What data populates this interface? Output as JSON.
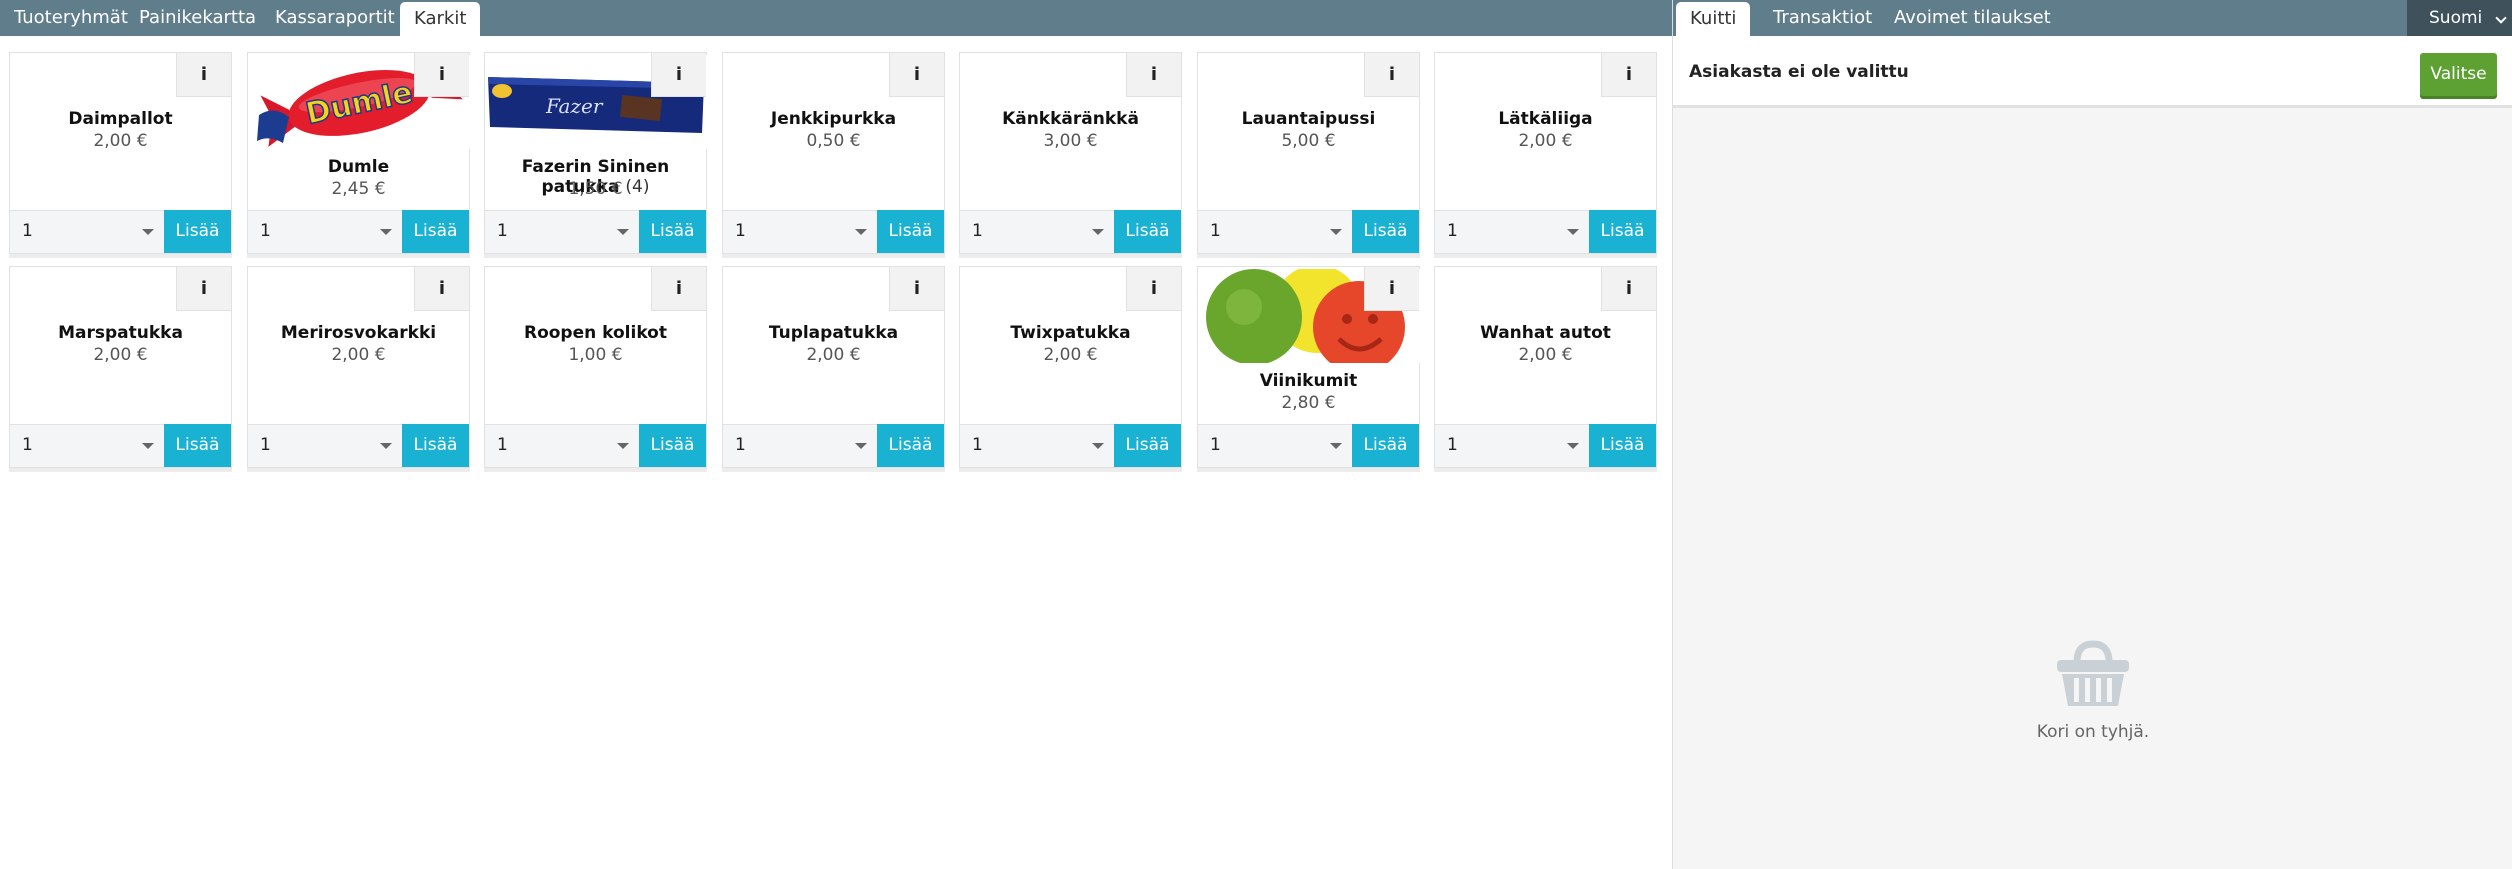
{
  "nav": {
    "tabs": [
      "Tuoteryhmät",
      "Painikekartta",
      "Kassaraportit",
      "Karkit"
    ],
    "active_tab": "Karkit"
  },
  "products": [
    {
      "name": "Daimpallot",
      "price": "2,00 €",
      "qty": "1",
      "add_label": "Lisää"
    },
    {
      "name": "Dumle",
      "price": "2,45 €",
      "qty": "1",
      "add_label": "Lisää",
      "image": "dumle-candy"
    },
    {
      "name": "Fazerin Sininen patukka",
      "qty_info": "(4)",
      "price": "1,50 €",
      "qty": "1",
      "add_label": "Lisää",
      "image": "fazer-bar"
    },
    {
      "name": "Jenkkipurkka",
      "price": "0,50 €",
      "qty": "1",
      "add_label": "Lisää"
    },
    {
      "name": "Känkkäränkkä",
      "price": "3,00 €",
      "qty": "1",
      "add_label": "Lisää"
    },
    {
      "name": "Lauantaipussi",
      "price": "5,00 €",
      "qty": "1",
      "add_label": "Lisää"
    },
    {
      "name": "Lätkäliiga",
      "price": "2,00 €",
      "qty": "1",
      "add_label": "Lisää"
    },
    {
      "name": "Marspatukka",
      "price": "2,00 €",
      "qty": "1",
      "add_label": "Lisää"
    },
    {
      "name": "Merirosvokarkki",
      "price": "2,00 €",
      "qty": "1",
      "add_label": "Lisää"
    },
    {
      "name": "Roopen kolikot",
      "price": "1,00 €",
      "qty": "1",
      "add_label": "Lisää"
    },
    {
      "name": "Tuplapatukka",
      "price": "2,00 €",
      "qty": "1",
      "add_label": "Lisää"
    },
    {
      "name": "Twixpatukka",
      "price": "2,00 €",
      "qty": "1",
      "add_label": "Lisää"
    },
    {
      "name": "Viinikumit",
      "price": "2,80 €",
      "qty": "1",
      "add_label": "Lisää",
      "image": "wine-gums"
    },
    {
      "name": "Wanhat autot",
      "price": "2,00 €",
      "qty": "1",
      "add_label": "Lisää"
    }
  ],
  "info_icon": "i",
  "sidebar": {
    "tabs": [
      "Kuitti",
      "Transaktiot",
      "Avoimet tilaukset"
    ],
    "active_tab": "Kuitti",
    "language": "Suomi",
    "customer_status": "Asiakasta ei ole valittu",
    "select_label": "Valitse",
    "empty_cart_text": "Kori on tyhjä.",
    "empty_icon": "basket-icon"
  },
  "colors": {
    "topbar": "#5f7d8b",
    "add_button": "#1ab2d3",
    "select_button": "#5ea133",
    "language_bg": "#3f525c"
  }
}
